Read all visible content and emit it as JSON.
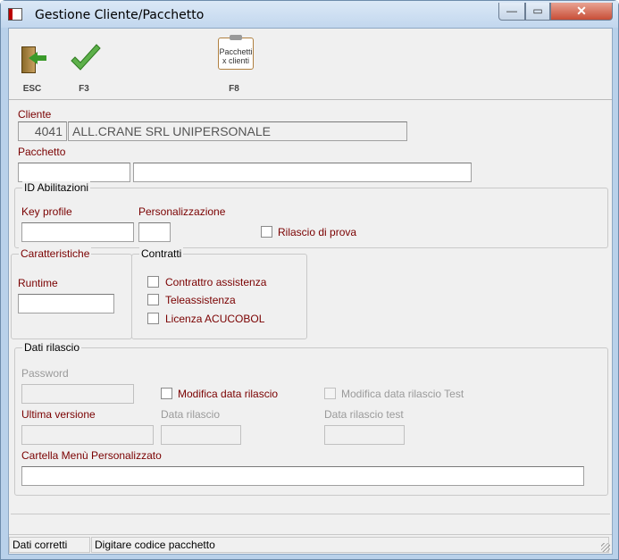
{
  "window": {
    "title": "Gestione Cliente/Pacchetto",
    "close_symbol": "✕",
    "min_symbol": "—",
    "max_symbol": "▭"
  },
  "toolbar": {
    "esc_label": "ESC",
    "f3_label": "F3",
    "f8_label": "F8",
    "f8_icon_text": "Pacchetti x clienti"
  },
  "form": {
    "cliente_label": "Cliente",
    "cliente_code": "4041",
    "cliente_name": "ALL.CRANE SRL UNIPERSONALE",
    "pacchetto_label": "Pacchetto",
    "pacchetto_code": "",
    "pacchetto_desc": "",
    "id_abilitazioni": {
      "caption": "ID Abilitazioni",
      "key_profile_label": "Key profile",
      "key_profile_value": "",
      "personalizzazione_label": "Personalizzazione",
      "personalizzazione_value": "",
      "rilascio_prova_label": "Rilascio di prova",
      "rilascio_prova_checked": false
    },
    "caratteristiche": {
      "caption": "Caratteristiche",
      "runtime_label": "Runtime",
      "runtime_value": ""
    },
    "contratti": {
      "caption": "Contratti",
      "items": [
        {
          "label": "Contrattro assistenza",
          "checked": false
        },
        {
          "label": "Teleassistenza",
          "checked": false
        },
        {
          "label": "Licenza ACUCOBOL",
          "checked": false
        }
      ]
    },
    "dati_rilascio": {
      "caption": "Dati rilascio",
      "password_label": "Password",
      "password_value": "",
      "modifica_data_label": "Modifica data rilascio",
      "modifica_data_test_label": "Modifica data rilascio Test",
      "ultima_versione_label": "Ultima versione",
      "ultima_versione_value": "",
      "data_rilascio_label": "Data rilascio",
      "data_rilascio_value": "",
      "data_rilascio_test_label": "Data rilascio test",
      "data_rilascio_test_value": "",
      "cartella_label": "Cartella Menù Personalizzato",
      "cartella_value": ""
    }
  },
  "statusbar": {
    "left": "Dati corretti",
    "right": "Digitare codice pacchetto"
  }
}
